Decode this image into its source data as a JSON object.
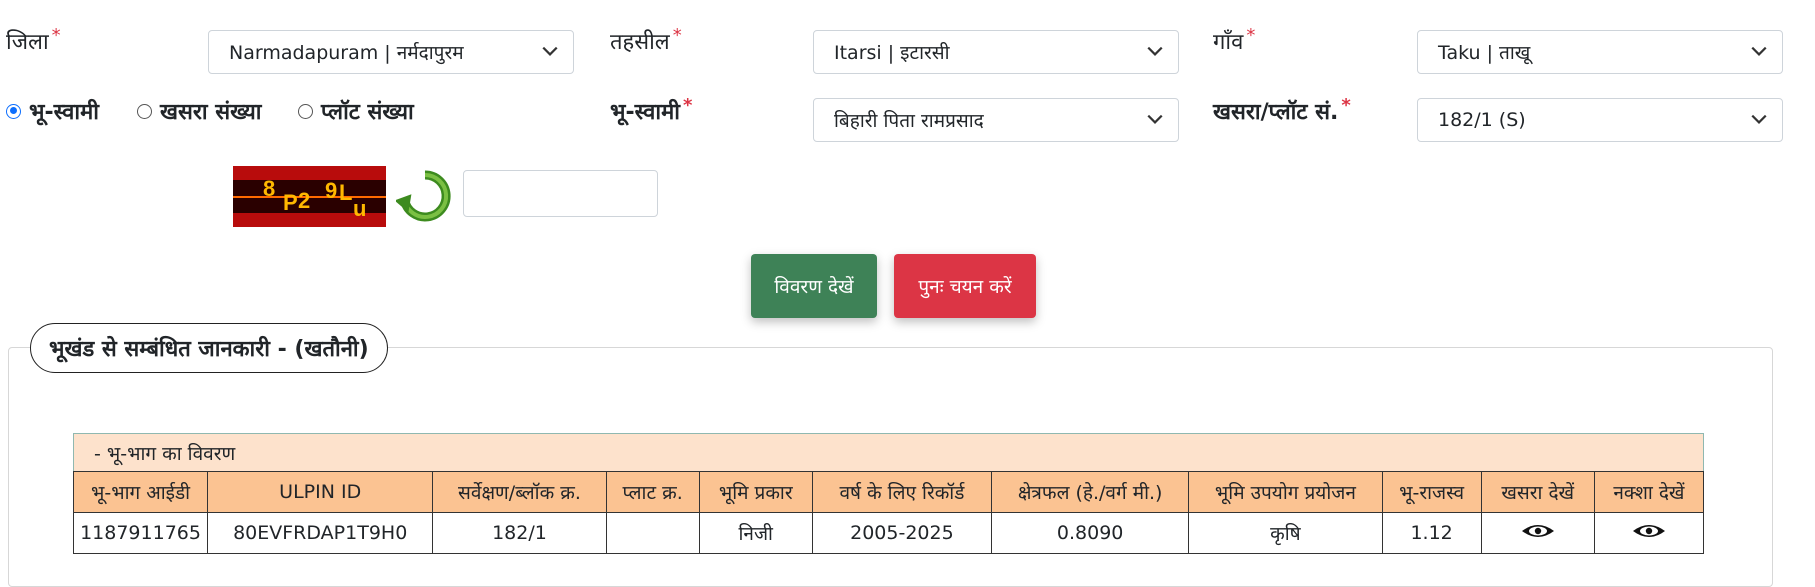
{
  "form": {
    "district_label": "जिला",
    "district_value": "Narmadapuram | नर्मदापुरम",
    "tehsil_label": "तहसील",
    "tehsil_value": "Itarsi | इटारसी",
    "village_label": "गाँव",
    "village_value": "Taku | ताखू",
    "radio_owner": "भू-स्वामी",
    "radio_khasra": "खसरा संख्या",
    "radio_plot": "प्लॉट संख्या",
    "owner_label": "भू-स्वामी",
    "owner_value": "बिहारी पिता रामप्रसाद",
    "khasra_label": "खसरा/प्लॉट सं.",
    "khasra_value": "182/1 (S)",
    "required_mark": "*",
    "captcha_text": "8P29Lu",
    "captcha_input": ""
  },
  "buttons": {
    "view_details": "विवरण देखें",
    "reselect": "पुनः चयन करें"
  },
  "section": {
    "legend": "भूखंड से सम्बंधित जानकारी -   (खतौनी)",
    "caption": "- भू-भाग का विवरण"
  },
  "table": {
    "headers": [
      "भू-भाग आईडी",
      "ULPIN ID",
      "सर्वेक्षण/ब्लॉक क्र.",
      "प्लाट क्र.",
      "भूमि प्रकार",
      "वर्ष के लिए रिकॉर्ड",
      "क्षेत्रफल (हे./वर्ग मी.)",
      "भूमि उपयोग प्रयोजन",
      "भू-राजस्व",
      "खसरा देखें",
      "नक्शा देखें"
    ],
    "row": {
      "parcel_id": "1187911765",
      "ulpin": "80EVFRDAP1T9H0",
      "survey_no": "182/1",
      "plot_no": "",
      "land_type": "निजी",
      "record_years": "2005-2025",
      "area": "0.8090",
      "land_use": "कृषि",
      "revenue": "1.12"
    }
  },
  "colors": {
    "view_button": "#3e8257",
    "reselect_button": "#dc3545",
    "header_bg": "#fbc392",
    "caption_bg": "#fde2cc",
    "radio_selected": "#0d6efd"
  }
}
